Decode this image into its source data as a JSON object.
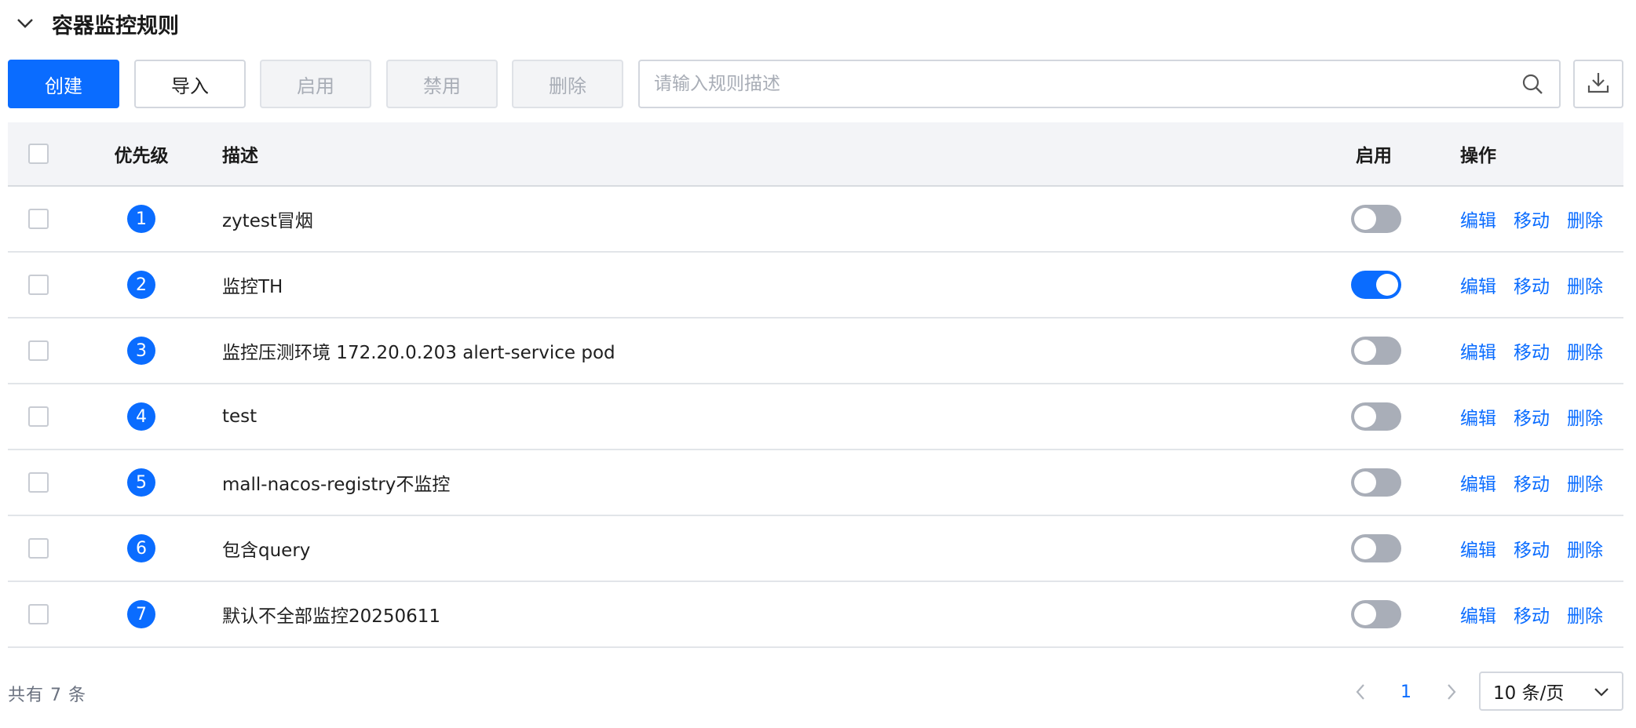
{
  "section": {
    "title": "容器监控规则"
  },
  "toolbar": {
    "create_label": "创建",
    "import_label": "导入",
    "enable_label": "启用",
    "disable_label": "禁用",
    "delete_label": "删除",
    "search_placeholder": "请输入规则描述"
  },
  "table": {
    "headers": {
      "priority": "优先级",
      "description": "描述",
      "enabled": "启用",
      "actions": "操作"
    },
    "rows": [
      {
        "priority": "1",
        "description": "zytest冒烟",
        "enabled": false
      },
      {
        "priority": "2",
        "description": "监控TH",
        "enabled": true
      },
      {
        "priority": "3",
        "description": "监控压测环境 172.20.0.203 alert-service pod",
        "enabled": false
      },
      {
        "priority": "4",
        "description": "test",
        "enabled": false
      },
      {
        "priority": "5",
        "description": "mall-nacos-registry不监控",
        "enabled": false
      },
      {
        "priority": "6",
        "description": "包含query",
        "enabled": false
      },
      {
        "priority": "7",
        "description": "默认不全部监控20250611",
        "enabled": false
      }
    ],
    "actions": {
      "edit": "编辑",
      "move": "移动",
      "delete": "删除"
    }
  },
  "footer": {
    "total": "共有 7 条",
    "current_page": "1",
    "page_size": "10 条/页"
  },
  "colors": {
    "primary": "#0a6cff",
    "toggle_off": "#a9aeb8",
    "header_bg": "#f3f4f7"
  }
}
